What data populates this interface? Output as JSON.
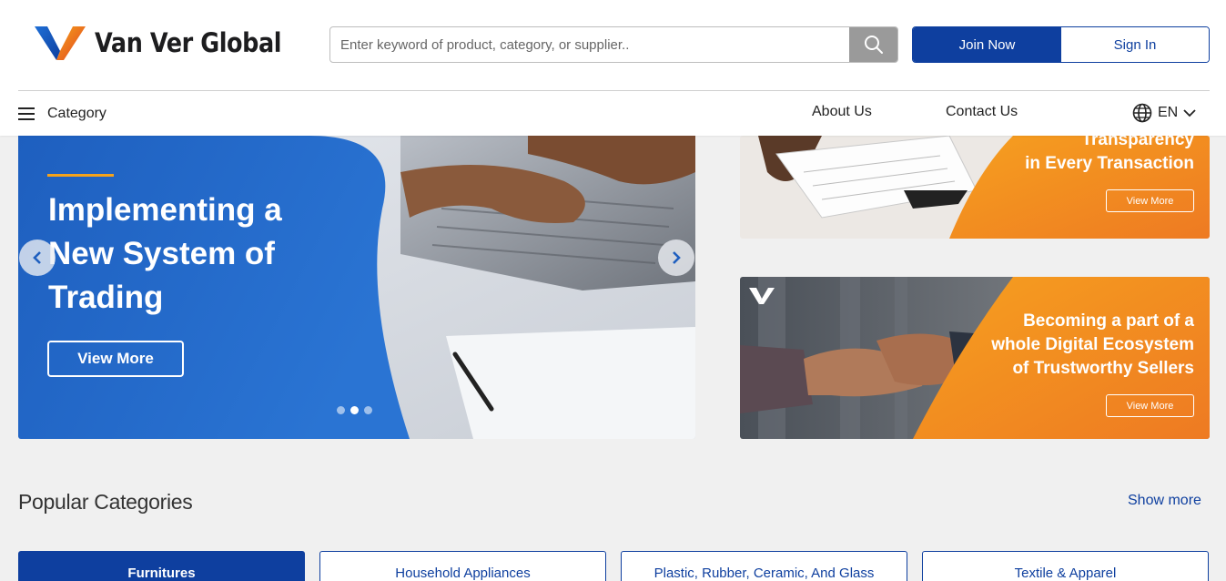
{
  "brand": {
    "name": "Van Ver Global",
    "primary_color": "#0e3f9f",
    "accent_orange": "#f28a1e"
  },
  "header": {
    "search_placeholder": "Enter keyword of product, category, or supplier..",
    "join_label": "Join Now",
    "signin_label": "Sign In",
    "category_label": "Category",
    "nav": {
      "about": "About Us",
      "contact": "Contact Us"
    },
    "language": "EN"
  },
  "hero": {
    "title_lines": [
      "Implementing a",
      "New System of",
      "Trading"
    ],
    "cta": "View More",
    "slides_count": 3,
    "active_slide": 2
  },
  "banners": [
    {
      "text_lines": [
        "Transparency",
        "in Every Transaction"
      ],
      "cta": "View More"
    },
    {
      "text_lines": [
        "Becoming a part of a",
        "whole Digital Ecosystem",
        "of Trustworthy Sellers"
      ],
      "cta": "View More"
    }
  ],
  "popular": {
    "title": "Popular Categories",
    "show_more": "Show more",
    "categories": [
      "Furnitures",
      "Household Appliances",
      "Plastic, Rubber, Ceramic, And Glass",
      "Textile & Apparel"
    ],
    "active_index": 0
  },
  "icons": [
    "logo-v-icon",
    "search-icon",
    "menu-icon",
    "globe-icon",
    "chevron-down-icon",
    "chevron-left-icon",
    "chevron-right-icon",
    "brand-v-icon"
  ]
}
